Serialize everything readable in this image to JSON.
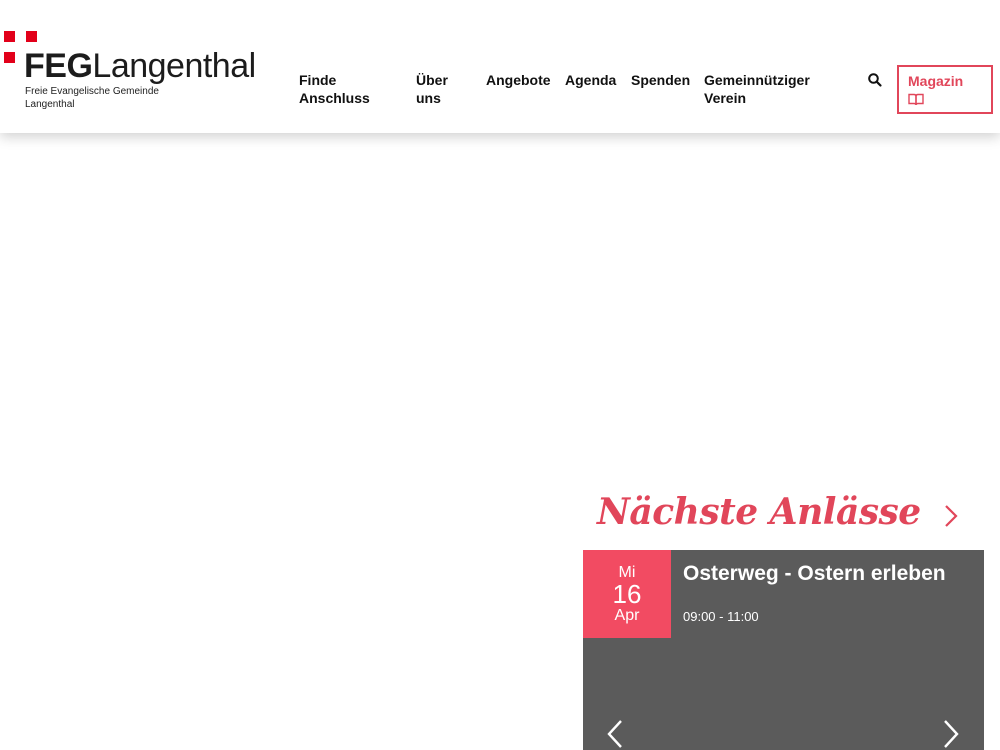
{
  "header": {
    "logo": {
      "brand_bold": "FEG",
      "brand_light": "Langenthal",
      "subtitle": "Freie Evangelische Gemeinde Langenthal"
    },
    "nav": [
      {
        "label": "Finde Anschluss"
      },
      {
        "label": "Über uns"
      },
      {
        "label": "Angebote"
      },
      {
        "label": "Agenda"
      },
      {
        "label": "Spenden"
      },
      {
        "label": "Gemeinnütziger Verein"
      }
    ],
    "search_icon": "search-icon",
    "magazin_label": "Magazin",
    "magazin_icon": "book-icon"
  },
  "events": {
    "title": "Nächste Anlässe",
    "items": [
      {
        "dow": "Mi",
        "day": "16",
        "month": "Apr",
        "title": "Osterweg - Ostern erleben",
        "time": "09:00 - 11:00"
      }
    ]
  },
  "colors": {
    "brand_red": "#e2001a",
    "accent": "#e1465a",
    "date_bg": "#f24b62",
    "card_bg": "#5b5b5b"
  }
}
